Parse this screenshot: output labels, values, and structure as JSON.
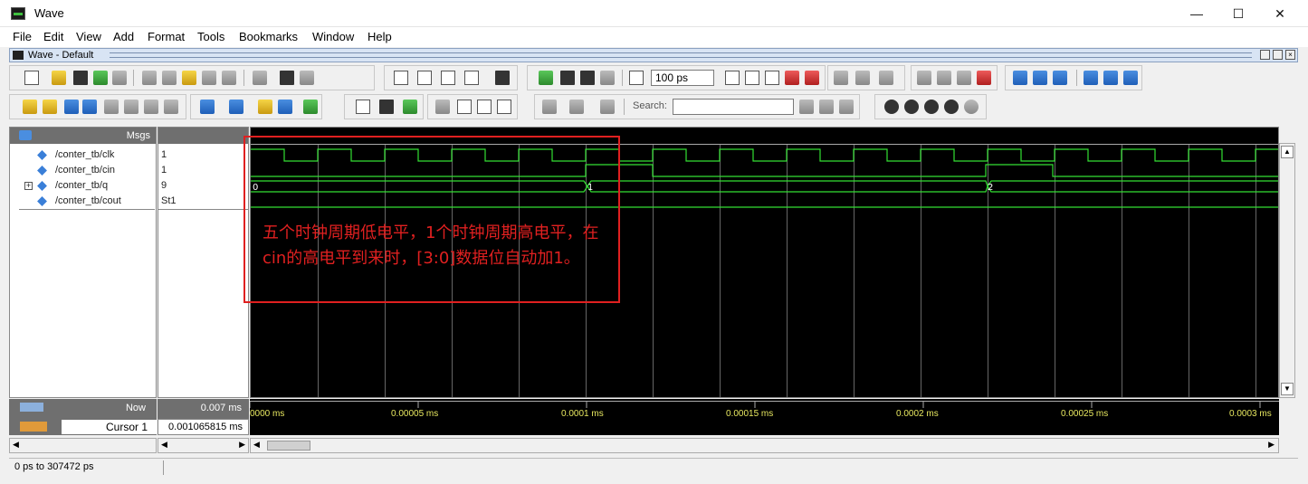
{
  "window": {
    "title": "Wave",
    "minimize": "—",
    "maximize": "☐",
    "close": "✕"
  },
  "menu": [
    "File",
    "Edit",
    "View",
    "Add",
    "Format",
    "Tools",
    "Bookmarks",
    "Window",
    "Help"
  ],
  "subwindow": {
    "title": "Wave - Default"
  },
  "toolbar": {
    "time_step_value": "100 ps",
    "search_label": "Search:",
    "search_value": ""
  },
  "name_header": "Msgs",
  "signals": [
    {
      "name": "/conter_tb/clk",
      "value": "1"
    },
    {
      "name": "/conter_tb/cin",
      "value": "1"
    },
    {
      "name": "/conter_tb/q",
      "value": "9",
      "expandable": "+"
    },
    {
      "name": "/conter_tb/cout",
      "value": "St1"
    }
  ],
  "q_values": [
    "0",
    "1",
    "2"
  ],
  "bottom": {
    "now_label": "Now",
    "now_value": "0.007 ms",
    "cursor_label": "Cursor 1",
    "cursor_value": "0.001065815 ms"
  },
  "timeline": [
    "0000 ms",
    "0.00005 ms",
    "0.0001 ms",
    "0.00015 ms",
    "0.0002 ms",
    "0.00025 ms",
    "0.0003 ms"
  ],
  "status": {
    "range": "0 ps to 307472 ps"
  },
  "annotation": {
    "text": "五个时钟周期低电平，1个时钟周期高电平，在cin的高电平到来时，[3:0]数据位自动加1。"
  },
  "colors": {
    "wave_bg": "#000000",
    "signal": "#33e033",
    "grid": "#777777",
    "annotation": "#e02020"
  }
}
